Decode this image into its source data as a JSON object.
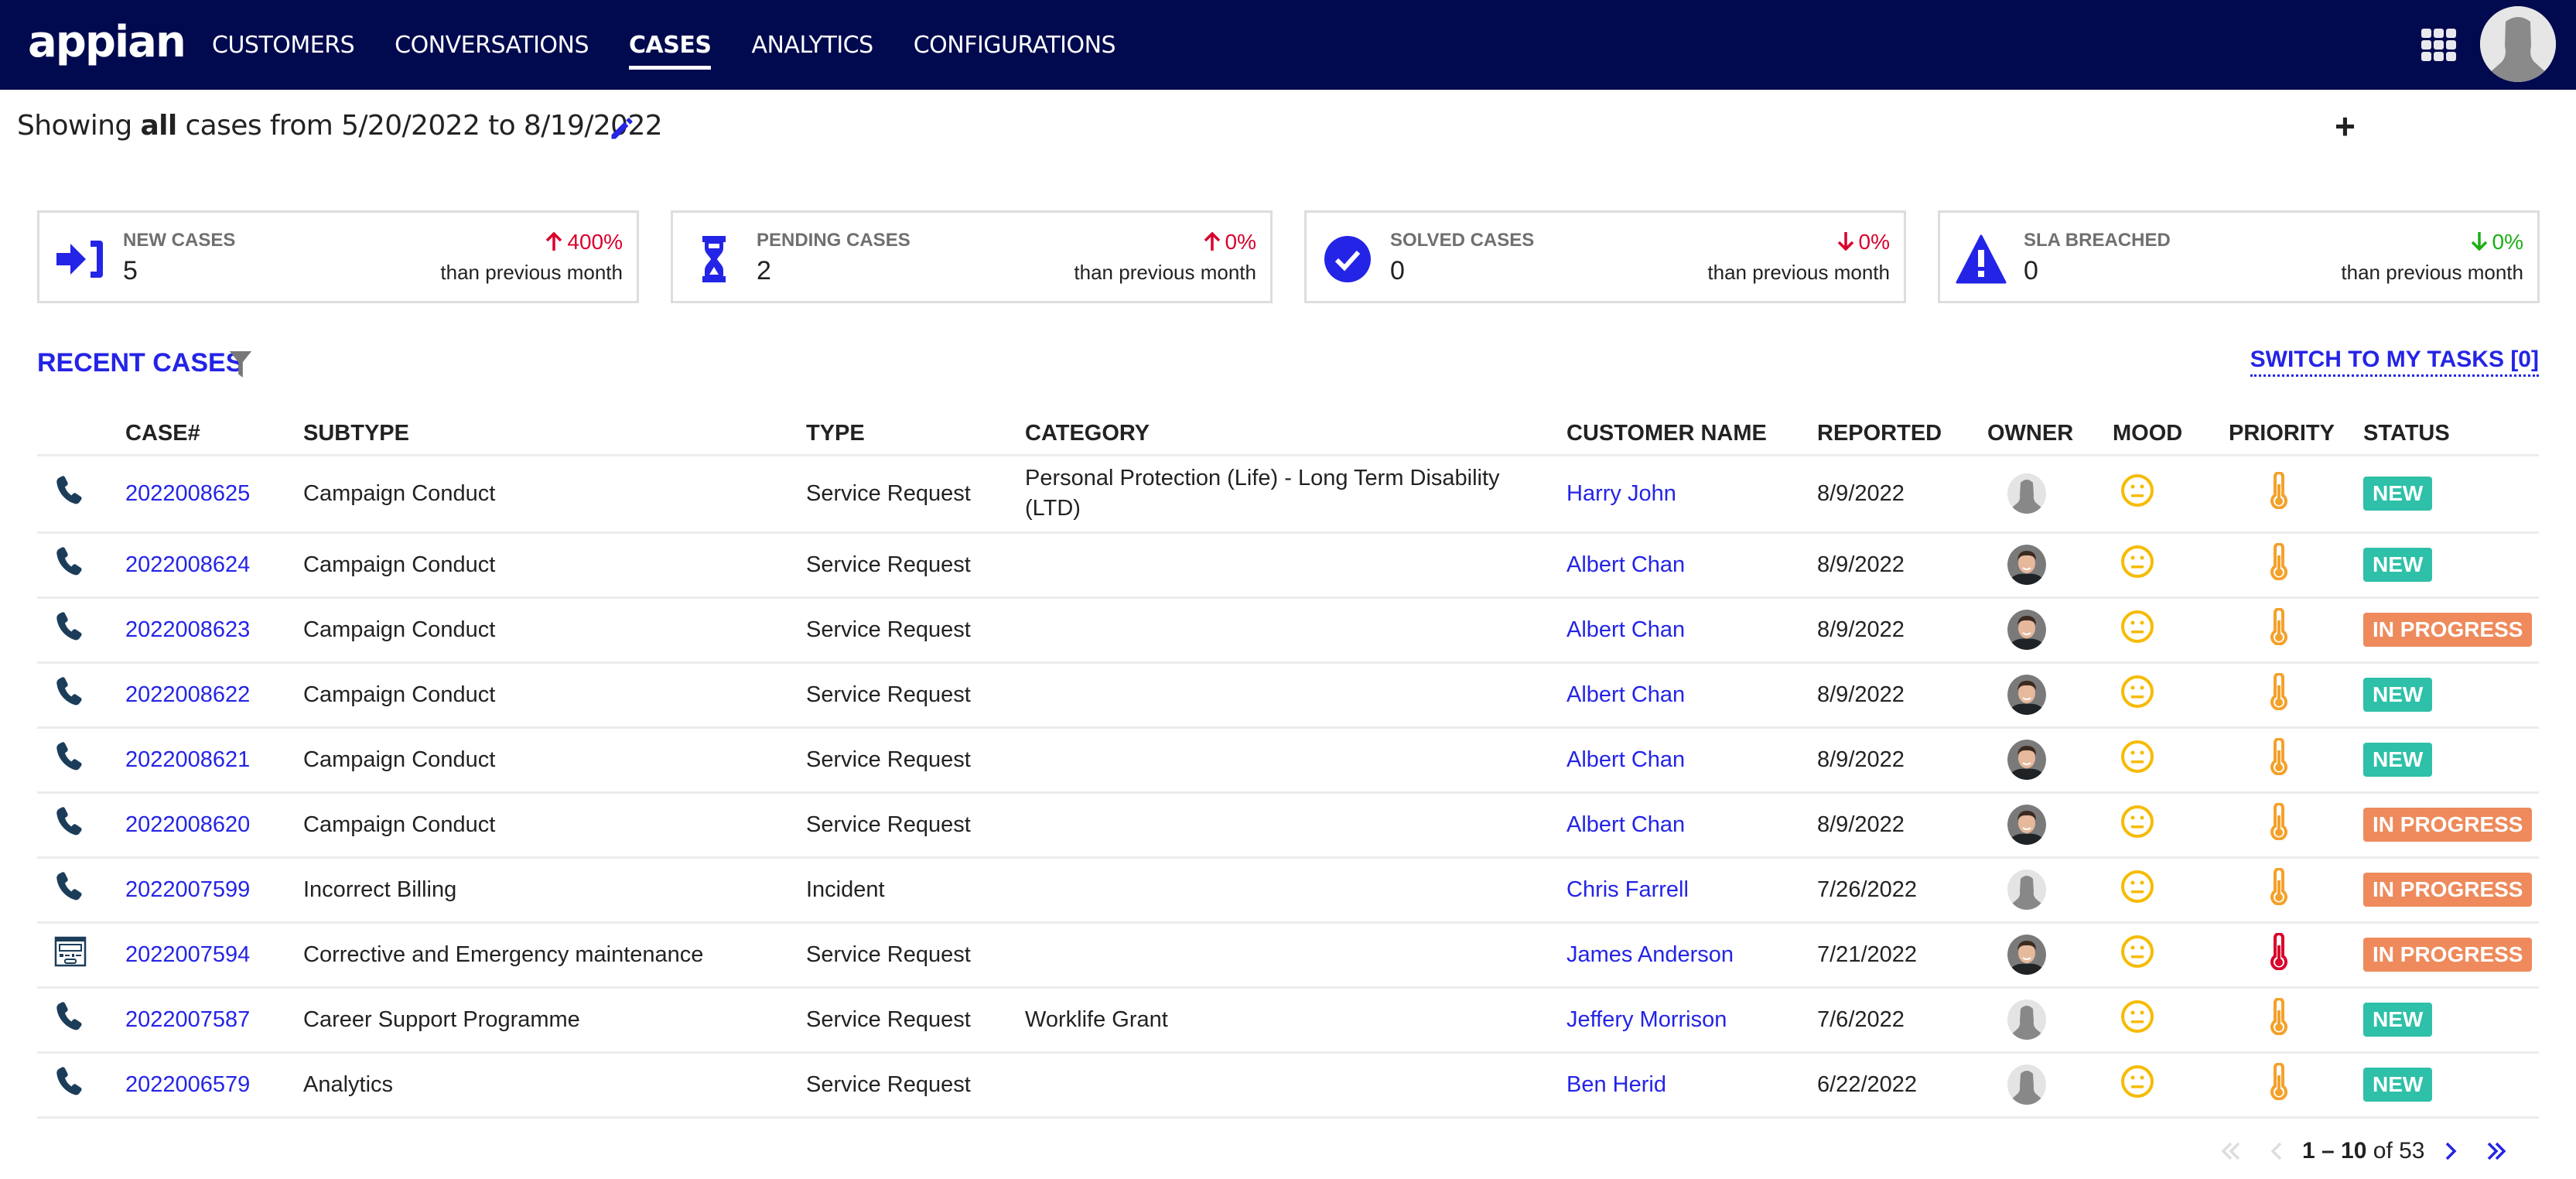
{
  "app": {
    "logo": "appian"
  },
  "nav": {
    "items": [
      {
        "label": "CUSTOMERS",
        "active": false
      },
      {
        "label": "CONVERSATIONS",
        "active": false
      },
      {
        "label": "CASES",
        "active": true
      },
      {
        "label": "ANALYTICS",
        "active": false
      },
      {
        "label": "CONFIGURATIONS",
        "active": false
      }
    ],
    "apps_icon": "grid-icon",
    "avatar_icon": "user-avatar-icon"
  },
  "filter_summary": {
    "prefix": "Showing ",
    "scope": "all",
    "middle": " cases from ",
    "start_date": "5/20/2022",
    "to": " to ",
    "end_date": "8/19/2022",
    "edit_icon": "pencil-icon"
  },
  "add_icon": "plus-icon",
  "kpis": [
    {
      "label": "NEW CASES",
      "value": "5",
      "change": "400%",
      "direction": "up",
      "change_color": "#d9002c",
      "sub": "than previous month",
      "icon": "sign-in-icon"
    },
    {
      "label": "PENDING CASES",
      "value": "2",
      "change": "0%",
      "direction": "up",
      "change_color": "#d9002c",
      "sub": "than previous month",
      "icon": "hourglass-icon"
    },
    {
      "label": "SOLVED CASES",
      "value": "0",
      "change": "0%",
      "direction": "down",
      "change_color": "#d9002c",
      "sub": "than previous month",
      "icon": "check-circle-icon"
    },
    {
      "label": "SLA BREACHED",
      "value": "0",
      "change": "0%",
      "direction": "down",
      "change_color": "#1bae14",
      "sub": "than previous month",
      "icon": "warning-icon"
    }
  ],
  "recent": {
    "title": "RECENT CASES",
    "filter_icon": "filter-icon",
    "switch_label": "SWITCH TO MY TASKS [0]"
  },
  "table": {
    "columns": [
      "",
      "CASE#",
      "SUBTYPE",
      "TYPE",
      "CATEGORY",
      "CUSTOMER NAME",
      "REPORTED",
      "OWNER",
      "MOOD",
      "PRIORITY",
      "STATUS"
    ],
    "rows": [
      {
        "channel": "phone",
        "case": "2022008625",
        "subtype": "Campaign Conduct",
        "type": "Service Request",
        "category": "Personal Protection (Life) - Long Term Disability (LTD)",
        "customer": "Harry John",
        "reported": "8/9/2022",
        "owner": "placeholder",
        "mood": "neutral",
        "priority": "medium",
        "status": "NEW"
      },
      {
        "channel": "phone",
        "case": "2022008624",
        "subtype": "Campaign Conduct",
        "type": "Service Request",
        "category": "",
        "customer": "Albert Chan",
        "reported": "8/9/2022",
        "owner": "photo",
        "mood": "neutral",
        "priority": "medium",
        "status": "NEW"
      },
      {
        "channel": "phone",
        "case": "2022008623",
        "subtype": "Campaign Conduct",
        "type": "Service Request",
        "category": "",
        "customer": "Albert Chan",
        "reported": "8/9/2022",
        "owner": "photo",
        "mood": "neutral",
        "priority": "medium",
        "status": "IN PROGRESS"
      },
      {
        "channel": "phone",
        "case": "2022008622",
        "subtype": "Campaign Conduct",
        "type": "Service Request",
        "category": "",
        "customer": "Albert Chan",
        "reported": "8/9/2022",
        "owner": "photo",
        "mood": "neutral",
        "priority": "medium",
        "status": "NEW"
      },
      {
        "channel": "phone",
        "case": "2022008621",
        "subtype": "Campaign Conduct",
        "type": "Service Request",
        "category": "",
        "customer": "Albert Chan",
        "reported": "8/9/2022",
        "owner": "photo",
        "mood": "neutral",
        "priority": "medium",
        "status": "NEW"
      },
      {
        "channel": "phone",
        "case": "2022008620",
        "subtype": "Campaign Conduct",
        "type": "Service Request",
        "category": "",
        "customer": "Albert Chan",
        "reported": "8/9/2022",
        "owner": "photo",
        "mood": "neutral",
        "priority": "medium",
        "status": "IN PROGRESS"
      },
      {
        "channel": "phone",
        "case": "2022007599",
        "subtype": "Incorrect Billing",
        "type": "Incident",
        "category": "",
        "customer": "Chris Farrell",
        "reported": "7/26/2022",
        "owner": "placeholder",
        "mood": "neutral",
        "priority": "medium",
        "status": "IN PROGRESS"
      },
      {
        "channel": "web-form",
        "case": "2022007594",
        "subtype": "Corrective and Emergency maintenance",
        "type": "Service Request",
        "category": "",
        "customer": "James Anderson",
        "reported": "7/21/2022",
        "owner": "photo",
        "mood": "neutral",
        "priority": "high",
        "status": "IN PROGRESS"
      },
      {
        "channel": "phone",
        "case": "2022007587",
        "subtype": "Career Support Programme",
        "type": "Service Request",
        "category": "Worklife Grant",
        "customer": "Jeffery Morrison",
        "reported": "7/6/2022",
        "owner": "placeholder",
        "mood": "neutral",
        "priority": "medium",
        "status": "NEW"
      },
      {
        "channel": "phone",
        "case": "2022006579",
        "subtype": "Analytics",
        "type": "Service Request",
        "category": "",
        "customer": "Ben Herid",
        "reported": "6/22/2022",
        "owner": "placeholder",
        "mood": "neutral",
        "priority": "medium",
        "status": "NEW"
      }
    ]
  },
  "pagination": {
    "range": "1 – 10",
    "of_label": " of ",
    "total": "53"
  },
  "colors": {
    "brand": "#020a4f",
    "accent": "#2424e6",
    "new": "#2ec0a8",
    "in_progress": "#ee8a5c",
    "mood": "#f6bb00",
    "priority_medium": "#f4a12a",
    "priority_high": "#d9002c"
  }
}
